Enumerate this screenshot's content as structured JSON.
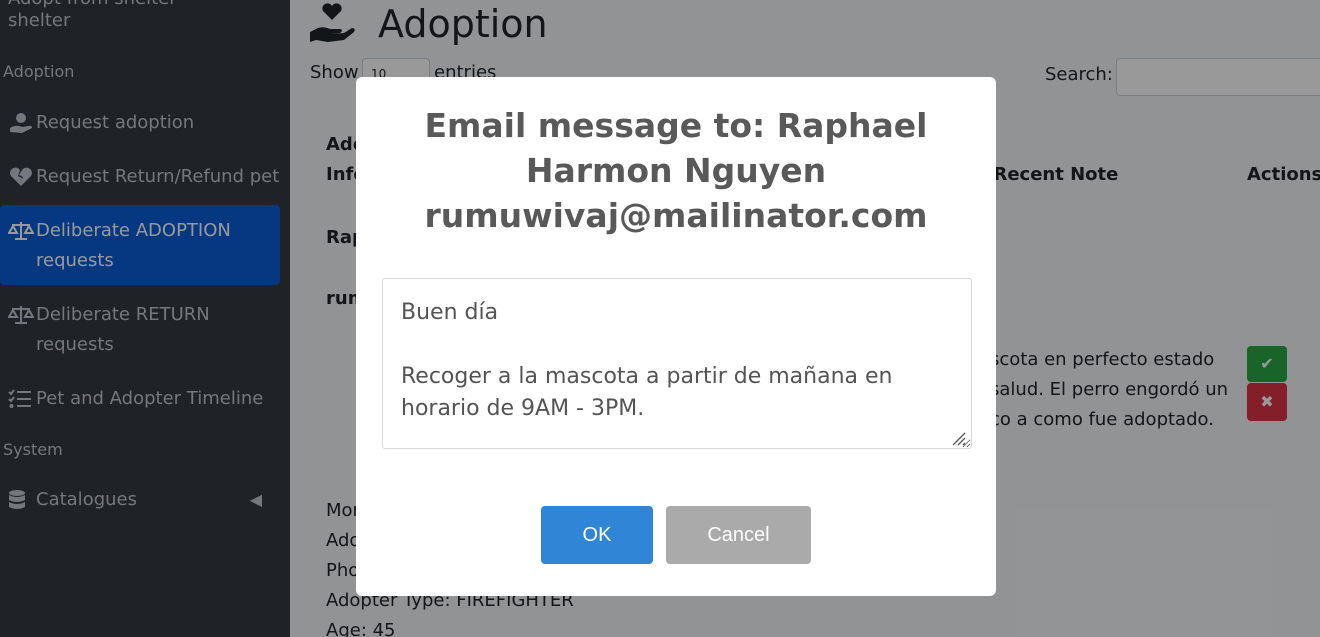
{
  "sidebar": {
    "top_text_clipped": "Adopt from shelter",
    "top_text": "shelter",
    "header_adoption": "Adoption",
    "items": [
      {
        "label": "Request adoption"
      },
      {
        "label": "Request Return/Refund pet"
      },
      {
        "label": "Deliberate ADOPTION requests"
      },
      {
        "label": "Deliberate RETURN requests"
      },
      {
        "label": "Pet and Adopter Timeline"
      }
    ],
    "header_system": "System",
    "catalogues": "Catalogues"
  },
  "main": {
    "title": "Adoption",
    "show_label": "Show",
    "show_value": "10",
    "entries_label": "entries",
    "search_label": "Search:",
    "table": {
      "col_adopter_line1": "Ado",
      "col_adopter_line2": "Info",
      "col_recent_note": ": Recent Note",
      "col_actions": "Actions",
      "row_name_fragment": "Rap",
      "row_email_fragment": "rum",
      "note_lines": [
        "scota en perfecto estado",
        "salud. El perro engordó un",
        "co a como fue adoptado."
      ],
      "detail_lines": [
        "Mor",
        "Add",
        "Pho",
        "Adopter Type: FIREFIGHTER",
        "Age: 45"
      ]
    }
  },
  "modal": {
    "title": "Email message to: Raphael Harmon Nguyen rumuwivaj@mailinator.com",
    "message": "Buen día\n\nRecoger a la mascota a partir de mañana en horario de 9AM - 3PM.",
    "confirm_label": "OK",
    "cancel_label": "Cancel"
  },
  "colors": {
    "sidebar_bg": "#343a40",
    "active_item": "#0b5ed7",
    "confirm_button": "#3085d6",
    "cancel_button": "#aaaaaa",
    "approve_button": "#28a745",
    "reject_button": "#dc3545"
  }
}
